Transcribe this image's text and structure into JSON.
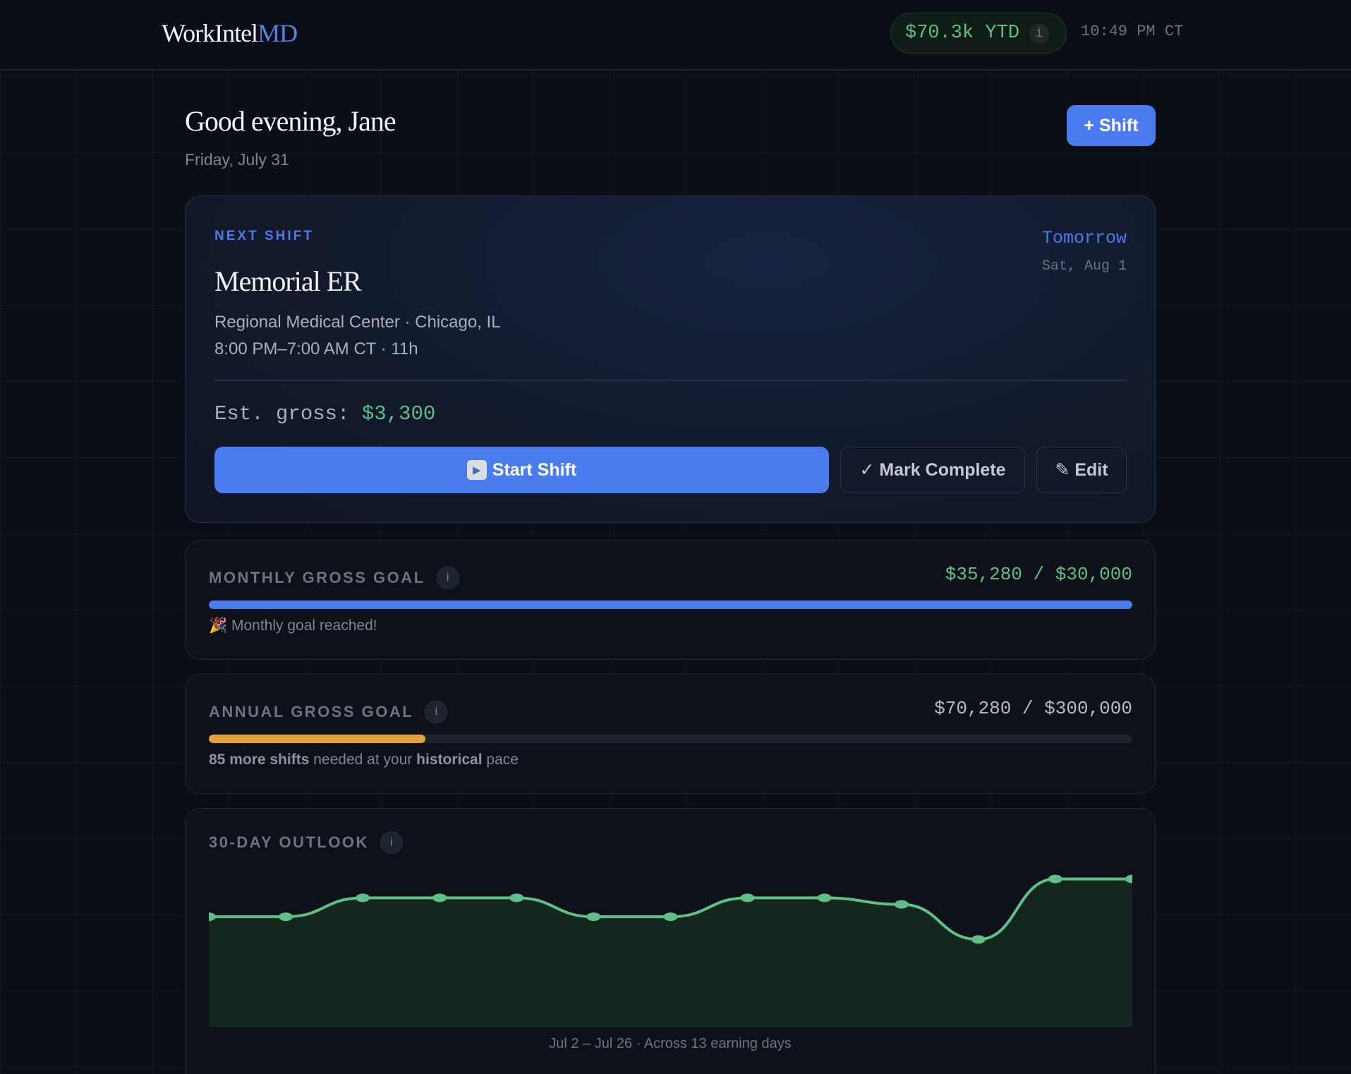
{
  "header": {
    "logo_main": "WorkIntel",
    "logo_accent": "MD",
    "ytd_label": "$70.3k YTD",
    "ytd_info": "i",
    "clock": "10:49 PM CT"
  },
  "greeting": {
    "title": "Good evening, Jane",
    "date": "Friday, July 31",
    "add_shift_label": "+ Shift"
  },
  "next_shift": {
    "section_label": "NEXT SHIFT",
    "when": "Tomorrow",
    "when_date": "Sat, Aug 1",
    "name": "Memorial ER",
    "location": "Regional Medical Center · Chicago, IL",
    "time": "8:00 PM–7:00 AM CT · 11h",
    "est_label": "Est. gross:",
    "est_value": "$3,300",
    "start_label": "Start Shift",
    "start_icon": "▶",
    "complete_label": "✓ Mark Complete",
    "edit_label": "✎ Edit"
  },
  "monthly_goal": {
    "title": "MONTHLY GROSS GOAL",
    "info": "i",
    "amount": "$35,280 / $30,000",
    "progress": 1.0,
    "fill_color": "#4a7cf0",
    "amount_color": "#5fbf86",
    "note": "🎉 Monthly goal reached!"
  },
  "annual_goal": {
    "title": "ANNUAL GROSS GOAL",
    "info": "i",
    "amount": "$70,280 / $300,000",
    "progress": 0.2343,
    "fill_color": "#e8a23c",
    "amount_color": "#b6bcc8",
    "note_bold1": "85 more shifts",
    "note_mid": " needed at your ",
    "note_bold2": "historical",
    "note_end": " pace"
  },
  "outlook": {
    "title": "30-DAY OUTLOOK",
    "info": "i",
    "caption": "Jul 2 – Jul 26 · Across 13 earning days"
  },
  "chart_data": {
    "type": "area",
    "title": "30-DAY OUTLOOK",
    "xlabel": "",
    "ylabel": "",
    "x": [
      0,
      1,
      2,
      3,
      4,
      5,
      6,
      7,
      8,
      9,
      10,
      11,
      12
    ],
    "values": [
      3300,
      3300,
      3575,
      3575,
      3575,
      3300,
      3300,
      3575,
      3575,
      3480,
      2970,
      3850,
      3850
    ],
    "ylim": [
      1700,
      4000
    ],
    "grid": false,
    "line_color": "#5fbf86",
    "fill_color": "#13271f"
  }
}
